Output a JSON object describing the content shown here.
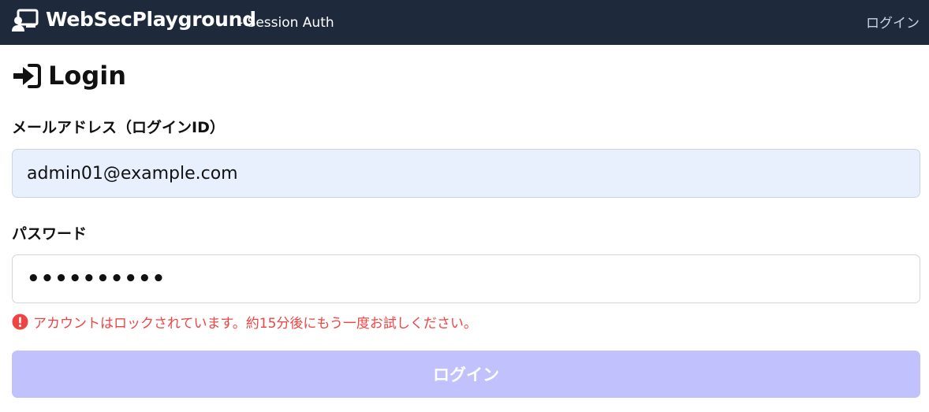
{
  "header": {
    "brand_name": "WebSecPlayground",
    "brand_sub": "- Session Auth",
    "brand_icon": "chalkboard-user-icon",
    "nav_login": "ログイン"
  },
  "page": {
    "title": "Login",
    "title_icon": "sign-in-arrow-icon"
  },
  "form": {
    "email_label": "メールアドレス（ログインID）",
    "email_value": "admin01@example.com",
    "password_label": "パスワード",
    "password_value": "••••••••••",
    "error_message": "アカウントはロックされています。約15分後にもう一度お試しください。",
    "error_icon": "exclamation-circle-icon",
    "submit_label": "ログイン"
  },
  "colors": {
    "topbar": "#1e293b",
    "error": "#ef4444",
    "submit_disabled": "#c0c1fd",
    "autofill_bg": "#e8f0fe"
  }
}
